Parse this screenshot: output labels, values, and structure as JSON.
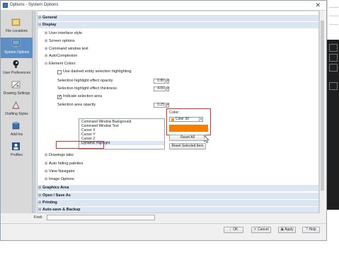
{
  "window": {
    "title": "Options - System Options",
    "close_glyph": "✕"
  },
  "sidebar": [
    {
      "label": "File Locations",
      "icon": "folder-locations-icon",
      "active": false
    },
    {
      "label": "System Options",
      "icon": "system-options-icon",
      "active": true
    },
    {
      "label": "User Preferences",
      "icon": "user-preferences-icon",
      "active": false
    },
    {
      "label": "Drawing Settings",
      "icon": "drawing-settings-icon",
      "active": false
    },
    {
      "label": "Drafting Styles",
      "icon": "drafting-styles-icon",
      "active": false
    },
    {
      "label": "Add-Ins",
      "icon": "add-ins-icon",
      "active": false
    },
    {
      "label": "Profiles",
      "icon": "profiles-icon",
      "active": false
    }
  ],
  "tree": {
    "general": "General",
    "display": "Display",
    "display_children": {
      "ui_style": "User interface style",
      "screen_options": "Screen options",
      "command_window_text": "Command window text",
      "autocomplexion": "AutoComplexion",
      "element_colors": "Element Colors"
    },
    "element_colors": {
      "dashed_label": "Use dashed entity selection highlighting",
      "dashed_checked": false,
      "opacity_label": "Selection highlight effect opacity",
      "opacity_value": "0.80",
      "thickness_label": "Selection highlight effect thickness",
      "thickness_value": "4.00",
      "indicate_label": "Indicate selection area",
      "indicate_checked": true,
      "area_opacity_label": "Selection area opacity",
      "area_opacity_value": "0.25"
    },
    "list_items": [
      "Command Window Background",
      "Command Window Text",
      "Cursor X",
      "Cursor Y",
      "Cursor Z",
      "Dynamic Highlight"
    ],
    "selected_item": "Dynamic Highlight",
    "color": {
      "label": "Color:",
      "value": "Color 30",
      "swatch_hex": "#f57f00"
    },
    "reset_all": "Reset All",
    "reset_selected": "Reset Selected Item",
    "after_children": {
      "drawings_tabs": "Drawings tabs",
      "auto_hiding": "Auto hiding palettes",
      "view_navigator": "View Navigator",
      "image_options": "Image Options"
    },
    "graphics_area": "Graphics Area",
    "open_save": "Open / Save As",
    "printing": "Printing",
    "autosave": "Auto-save & Backup"
  },
  "find": {
    "label": "Find:",
    "value": ""
  },
  "buttons": {
    "ok": "OK",
    "cancel": "Cancel",
    "apply": "Apply",
    "help": "Help"
  },
  "colors": {
    "accent": "#5e8fc4",
    "highlight_red": "#d8312f",
    "section_bg": "#dce6f3",
    "orange": "#f57f00"
  }
}
